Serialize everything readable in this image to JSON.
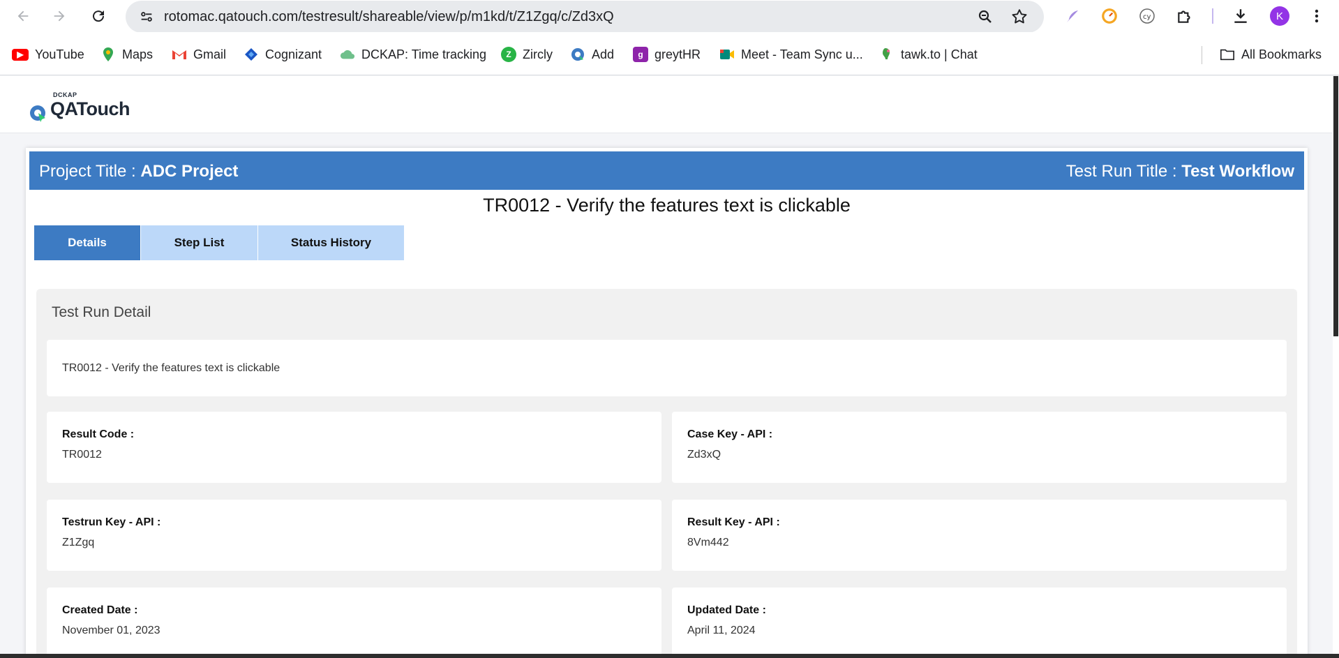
{
  "browser": {
    "url": "rotomac.qatouch.com/testresult/shareable/view/p/m1kd/t/Z1Zgq/c/Zd3xQ",
    "profile_initial": "K",
    "bookmarks": [
      {
        "label": "YouTube",
        "icon": "youtube-icon",
        "color": "#ff0000"
      },
      {
        "label": "Maps",
        "icon": "maps-icon",
        "color": "#34a853"
      },
      {
        "label": "Gmail",
        "icon": "gmail-icon",
        "color": "#ea4335"
      },
      {
        "label": "Cognizant",
        "icon": "cognizant-icon",
        "color": "#1a56c4"
      },
      {
        "label": "DCKAP: Time tracking",
        "icon": "cloud-icon",
        "color": "#5fb878"
      },
      {
        "label": "Zircly",
        "icon": "zircly-icon",
        "color": "#28b446"
      },
      {
        "label": "Add",
        "icon": "qatouch-icon",
        "color": "#3d7bc3"
      },
      {
        "label": "greytHR",
        "icon": "greythr-icon",
        "color": "#8e24aa"
      },
      {
        "label": "Meet - Team Sync u...",
        "icon": "meet-icon",
        "color": "#00897b"
      },
      {
        "label": "tawk.to | Chat",
        "icon": "tawk-icon",
        "color": "#43a047"
      }
    ],
    "all_bookmarks": "All Bookmarks"
  },
  "site": {
    "logo_small": "DCKAP",
    "logo_brand": "QATouch"
  },
  "banner": {
    "project_label": "Project Title : ",
    "project_value": "ADC Project",
    "run_label": "Test Run Title : ",
    "run_value": "Test Workflow"
  },
  "case_title": "TR0012 - Verify the features text is clickable",
  "tabs": [
    {
      "label": "Details",
      "active": true
    },
    {
      "label": "Step List",
      "active": false
    },
    {
      "label": "Status History",
      "active": false
    }
  ],
  "detail": {
    "heading": "Test Run Detail",
    "description": "TR0012 - Verify the features text is clickable",
    "fields": [
      {
        "label": "Result Code :",
        "value": "TR0012"
      },
      {
        "label": "Case Key - API :",
        "value": "Zd3xQ"
      },
      {
        "label": "Testrun Key - API :",
        "value": "Z1Zgq"
      },
      {
        "label": "Result Key - API :",
        "value": "8Vm442"
      },
      {
        "label": "Created Date :",
        "value": "November 01, 2023"
      },
      {
        "label": "Updated Date :",
        "value": "April 11, 2024"
      }
    ]
  },
  "colors": {
    "brand_blue": "#3d7bc3",
    "tab_light": "#bcd8f9"
  }
}
